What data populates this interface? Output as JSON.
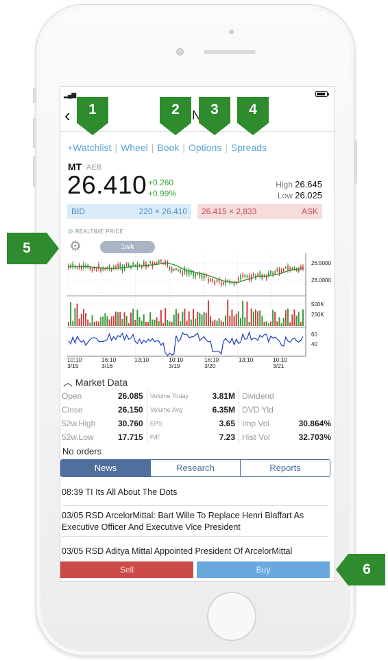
{
  "header": {
    "symbol_partial": "N"
  },
  "links": [
    "+Watchlist",
    "Wheel",
    "Book",
    "Options",
    "Spreads"
  ],
  "quote": {
    "symbol": "MT",
    "exchange": "AEB",
    "price": "26.410",
    "change": "+0.260",
    "change_pct": "+0.99%",
    "high_label": "High",
    "high": "26.645",
    "low_label": "Low",
    "low": "26.025"
  },
  "bid": {
    "label": "BID",
    "size_price": "220 × 26.410"
  },
  "ask": {
    "label": "ASK",
    "price_size": "26.415 × 2,833"
  },
  "realtime_label": "REALTIME PRICE",
  "chart": {
    "range_label": "1wk",
    "price_ticks": [
      "26.5000",
      "26.0000"
    ],
    "volume_ticks": [
      "500K",
      "250K"
    ],
    "rsi_ticks": [
      "60",
      "40"
    ],
    "x_times": [
      "10:10",
      "16:10",
      "13:10",
      "10:10",
      "16:10",
      "13:10",
      "10:10"
    ],
    "x_dates": [
      "3/15",
      "3/16",
      "",
      "3/19",
      "3/20",
      "",
      "3/21"
    ]
  },
  "chart_data": {
    "type": "line",
    "x": [
      "3/15 10:10",
      "3/16 16:10",
      "3/16 13:10",
      "3/19 10:10",
      "3/20 16:10",
      "3/20 13:10",
      "3/21 10:10"
    ],
    "series": [],
    "y_ticks": [
      "26.0000",
      "26.5000"
    ],
    "volume_ticks": [
      "250K",
      "500K"
    ],
    "indicator_ticks": [
      "40",
      "60"
    ]
  },
  "market_data": {
    "title": "Market Data",
    "rows": [
      {
        "l1": "Open",
        "v1": "26.085",
        "l2": "Volume Today",
        "v2": "3.81M",
        "l3": "Dividend",
        "v3": ""
      },
      {
        "l1": "Close",
        "v1": "26.150",
        "l2": "Volume Avg",
        "v2": "6.35M",
        "l3": "DVD Yld",
        "v3": ""
      },
      {
        "l1": "52w.High",
        "v1": "30.760",
        "l2": "EPS",
        "v2": "3.65",
        "l3": "Imp Vol",
        "v3": "30.864%"
      },
      {
        "l1": "52w.Low",
        "v1": "17.715",
        "l2": "P/E",
        "v2": "7.23",
        "l3": "Hist Vol",
        "v3": "32.703%"
      }
    ]
  },
  "no_orders": "No orders",
  "tabs": [
    "News",
    "Research",
    "Reports"
  ],
  "news": [
    "08:39 TI Its All About The Dots",
    "03/05 RSD ArcelorMittal: Bart Wille To Replace Henri Blaffart As Executive Officer And Executive Vice President",
    "03/05 RSD Aditya Mittal Appointed President Of ArcelorMittal"
  ],
  "actions": {
    "sell": "Sell",
    "buy": "Buy"
  },
  "callouts": [
    "1",
    "2",
    "3",
    "4",
    "5",
    "6"
  ],
  "colors": {
    "accent_link": "#5aa6d8",
    "up": "#3aa53a",
    "down": "#c84a4a",
    "callout": "#2e8b2e",
    "tab_active": "#4f6f9d"
  }
}
